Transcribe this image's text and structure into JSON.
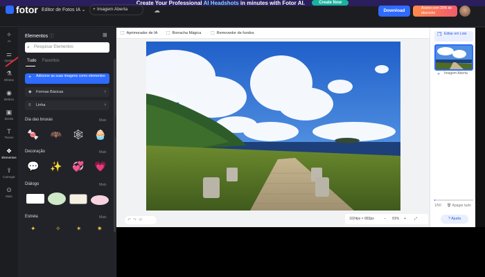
{
  "banner": {
    "text_pre": "Create Your Professional ",
    "highlight": "AI Headshots",
    "text_post": " in minutes with Fotor AI.",
    "cta": "Create Now"
  },
  "header": {
    "logo": "fotor",
    "editor_menu": "Editor de Fotos IA",
    "upload_button": "Imagem Aberta",
    "download_button": "Download",
    "promo": "Assine com 20% de desconto",
    "cloud_icon": "cloud-icon"
  },
  "rail": [
    {
      "label": "AI",
      "icon": "sparkle-icon"
    },
    {
      "label": "Ajustar",
      "icon": "sliders-icon"
    },
    {
      "label": "Efeitos",
      "icon": "flask-icon"
    },
    {
      "label": "Beleza",
      "icon": "eye-icon"
    },
    {
      "label": "Borda",
      "icon": "frame-icon"
    },
    {
      "label": "Textos",
      "icon": "text-icon"
    },
    {
      "label": "Elementos",
      "icon": "shapes-icon"
    },
    {
      "label": "Carregar",
      "icon": "upload-icon"
    },
    {
      "label": "Mais",
      "icon": "more-icon"
    }
  ],
  "panel": {
    "title": "Elementos",
    "search_placeholder": "Pesquisar Elementos",
    "tabs": [
      "Tudo",
      "Favoritos"
    ],
    "add_button": "Adicione as suas imagens como elementos",
    "options": [
      "Formas Básicas",
      "Linha"
    ],
    "more_label": "Mais",
    "sections": [
      {
        "title": "Dia das bruxas",
        "stickers": [
          "🍬",
          "🦇",
          "🕸",
          "🧁"
        ]
      },
      {
        "title": "Decoração",
        "stickers": [
          "💬",
          "✨",
          "💞",
          "💗"
        ]
      },
      {
        "title": "Diálogo",
        "stickers": [
          "▭",
          "◯",
          "🗨",
          "⬭"
        ]
      },
      {
        "title": "Estrela",
        "stickers": [
          "✦",
          "✧",
          "✶",
          "✷"
        ]
      }
    ]
  },
  "toolbar": {
    "tools": [
      "Aprimorador de IA",
      "Borracha Mágica",
      "Removedor de fundos"
    ]
  },
  "canvas": {
    "dimensions": "1024px × 683px",
    "zoom": "91%",
    "zoom_minus": "−",
    "zoom_plus": "+"
  },
  "right_panel": {
    "batch_button": "Editar em Lote",
    "add_image": "Imagem Aberta",
    "count": "1/50",
    "clear": "Apagar tudo",
    "help": "Ajuda",
    "progress": 0.02
  }
}
